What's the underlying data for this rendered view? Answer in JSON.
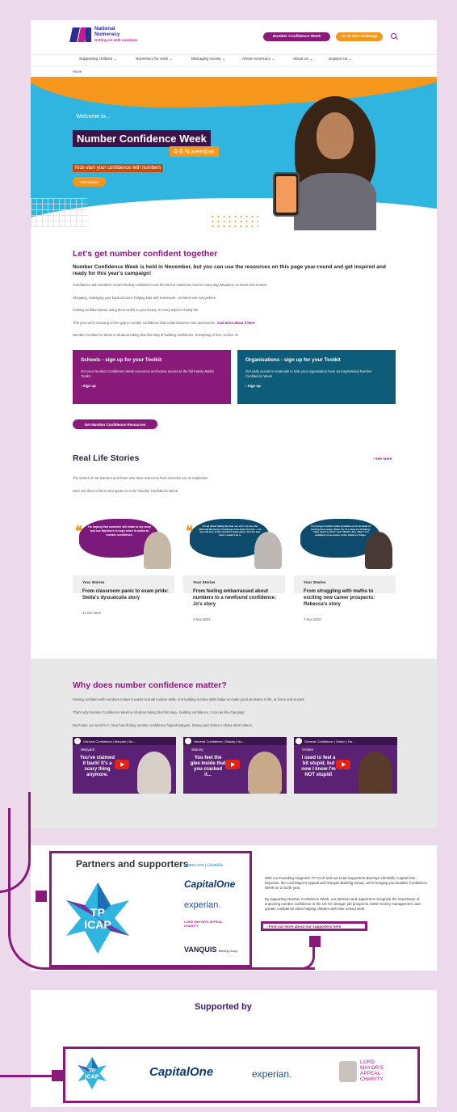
{
  "header": {
    "logo_line1": "National",
    "logo_line2": "Numeracy",
    "logo_tagline": "Getting on with numbers",
    "btn_ncw": "Number Confidence Week",
    "btn_challenge": "Go to the Challenge"
  },
  "nav": [
    "Supporting children ⌄",
    "Numeracy for work ⌄",
    "Managing money ⌄",
    "About numeracy ⌄",
    "About us ⌄",
    "Support us ⌄"
  ],
  "breadcrumb": "Home",
  "hero": {
    "welcome": "Welcome to...",
    "title": "Number Confidence Week",
    "dates": "4-8 November",
    "kickstart": "Kick-start your confidence with numbers",
    "cta": "Get started",
    "chevrons": "‹‹‹‹"
  },
  "intro": {
    "heading": "Let's get number confident together",
    "lead": "Number Confidence Week is held in November, but you can use the resources on this page year-round and get inspired and ready for this year's campaign!",
    "p1": "'Confidence with numbers' means feeling confident to use the kind of maths we need in every-day situations, at home and at work.",
    "p2": "Shopping, managing your bank account, helping kids with homework...numbers are everywhere.",
    "p3": "Feeling confident about using them works in your favour, in every aspect of daily life.",
    "p4": "This year we're focusing on the gap in number confidence that exists between men and women.",
    "p4_link": "read more about it here.",
    "p5": "Number Confidence Week is all about taking that first step of building confidence. Everything is free, so dive in!"
  },
  "toolkits": [
    {
      "title": "Schools - sign up for your Toolkit",
      "desc": "Get your Number Confidence Week resources and bonus access to the full Family Maths Toolkit",
      "link": "› Sign up"
    },
    {
      "title": "Organisations - sign up for your Toolkit",
      "desc": "Get early access to materials to help your organisation have an inspirational Number Confidence Week",
      "link": "› Sign up"
    }
  ],
  "resources_btn": "Get Number Confidence Resources",
  "stories": {
    "heading": "Real Life Stories",
    "see_more": "› See more",
    "p1": "The stories of our learners and those who have overcome their anxieties are an inspiration.",
    "p2": "Here are three of them who spoke to us for Number Confidence Week.",
    "cards": [
      {
        "quote": "I'm hoping that someone will relate to my story and see that there is hope when it comes to number confidence.",
        "type": "Your Stories",
        "title": "From classroom panic to exam pride: Stella's dyscalculia story",
        "date": "31 Oct 2023"
      },
      {
        "quote": "It's all about taking the fear out of it. For me, the National Numeracy Challenge took away the fear – not just the fear of the numbers themselves, but the fear that I couldn't do it.",
        "type": "Your Stories",
        "title": "From feeling embarrassed about numbers to a newfound confidence: Jo's story",
        "date": "3 Nov 2023"
      },
      {
        "quote": "I'm trying to tackle maths problems more instead of turning them away. When I'm in a shop I'm thinking: \"How much is this?\" and \"What's this offer?\" I'm definitely more aware of the maths in things.",
        "type": "Your Stories",
        "title": "From struggling with maths to exciting new career prospects: Rebecca's story",
        "date": "7 Nov 2023"
      }
    ]
  },
  "why": {
    "heading": "Why does number confidence matter?",
    "p1": "Feeling confident with numbers makes it easier to build number skills. And building number skills helps us make good decisions in life, at home and at work.",
    "p2": "That's why Number Confidence Week is all about taking that first step...building confidence. It can be life-changing!",
    "p3": "Don't take our word for it, hear how finding number confidence helped Maryam, Stacey and Orsleo in these short videos...",
    "videos": [
      {
        "bar": "General Confidence | Maryam | Nu...",
        "name": "Maryam",
        "line": "You've claimed it back! It's a scary thing anymore."
      },
      {
        "bar": "General Confidence | Stacey | Nu...",
        "name": "Stacey",
        "line": "You feel the glee inside that you cracked it..."
      },
      {
        "bar": "General Confidence | Orsleo | Nu...",
        "name": "Orsleo",
        "line": "I used to feel a bit stupid, but now I know I'm NOT stupid!"
      }
    ]
  },
  "partners": {
    "heading": "Partners and supporters",
    "tp_line1": "TP",
    "tp_line2": "ICAP",
    "logo_barclays": "BARCLAYS | LifeSkills",
    "logo_capitalone": "CapitalOne",
    "logo_experian": "experian.",
    "logo_lordmayor": "LORD MAYOR'S APPEAL CHARITY",
    "logo_vanquis": "VANQUIS",
    "logo_vanquis_sub": "Banking Group",
    "p1": "With our Founding Supporter TP ICAP and our Lead Supporters Barclays LifeSkills, Capital One, Experian, the Lord Mayor's Appeal and Vanquis Banking Group, we're bringing you Number Confidence Week for a fourth year.",
    "p2": "By supporting Number Confidence Week, our partners and supporters recognise the importance of improving number confidence in the UK for stronger job prospects, better money management, and greater confidence when helping children with their school work.",
    "find_out": "› Find out more about our supporters here"
  },
  "supported": {
    "heading": "Supported by",
    "tp_line1": "TP",
    "tp_line2": "ICAP",
    "logo_capitalone": "CapitalOne",
    "logo_experian": "experian.",
    "lm_line1": "LORD",
    "lm_line2": "MAYOR'S",
    "lm_line3": "APPEAL",
    "lm_line4": "CHARITY"
  },
  "colors": {
    "brand_purple": "#8a1a7a",
    "brand_orange": "#f5961d",
    "brand_blue": "#2fb5df",
    "dark_teal": "#0d5c7a"
  }
}
